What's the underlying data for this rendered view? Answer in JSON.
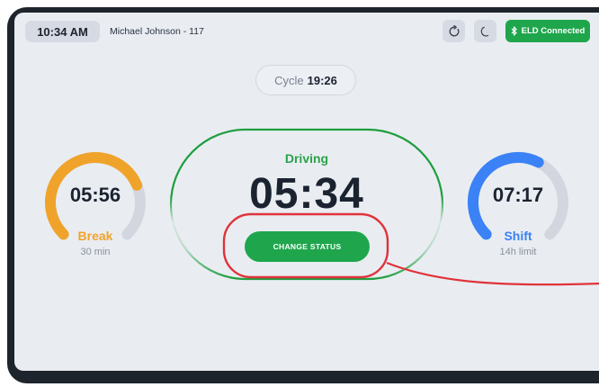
{
  "header": {
    "time": "10:34 AM",
    "driver": "Michael Johnson - 117",
    "eld_label": "ELD Connected",
    "icons": [
      "refresh-icon",
      "moon-icon",
      "bluetooth-icon"
    ]
  },
  "cycle": {
    "label": "Cycle",
    "value": "19:26"
  },
  "break_gauge": {
    "time": "05:56",
    "label": "Break",
    "sub": "30 min",
    "color": "#f0a32a",
    "progress": 0.75
  },
  "driving": {
    "status": "Driving",
    "time": "05:34",
    "button": "CHANGE STATUS",
    "color": "#2aa34a"
  },
  "shift_gauge": {
    "time": "07:17",
    "label": "Shift",
    "sub": "14h limit",
    "color": "#3b82f6",
    "progress": 0.6
  },
  "colors": {
    "accent_green": "#1fa64c",
    "highlight_red": "#e0333a",
    "track": "#d4d6df"
  }
}
